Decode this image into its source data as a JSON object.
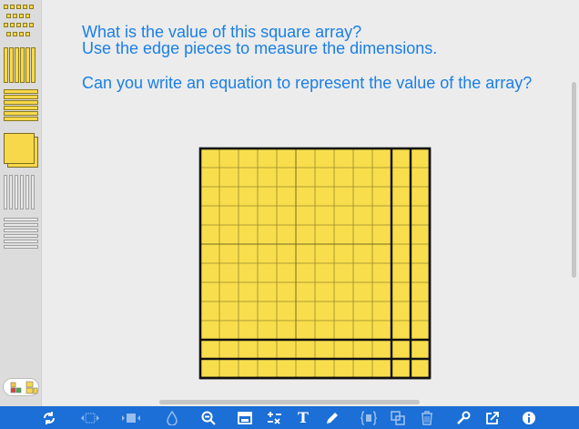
{
  "prompt": {
    "line1": "What is the value of this square array?",
    "line2": "Use the edge pieces to measure the dimensions.",
    "line3": "Can you write an equation to represent the value of the array?"
  },
  "array": {
    "fill_color": "#f8de4d",
    "grid_color": "#9a8a2a",
    "border_color": "#111111",
    "hundreds_grid": {
      "rows": 10,
      "cols": 10
    },
    "ten_rods_right": 2,
    "ten_rods_bottom": 2,
    "unit_squares": 4
  },
  "palette": {
    "items": [
      "ones-pieces",
      "ten-rods-vertical",
      "ten-rods-horizontal",
      "hundred-flat",
      "blank-ten-rods-vertical",
      "blank-ten-rods-horizontal"
    ],
    "accent": "#f7d84a"
  },
  "toolbar": {
    "bg_color": "#1b6fd6",
    "buttons": [
      "rotate-icon",
      "group-tiles-icon",
      "ungroup-tiles-icon",
      "drop-icon",
      "zoom-out-icon",
      "window-icon",
      "add-subtract-icon",
      "text-tool-icon",
      "pen-icon",
      "group-bracket-icon",
      "duplicate-icon",
      "trash-icon",
      "wrench-icon",
      "share-icon",
      "info-icon"
    ],
    "text_tool_label": "T"
  }
}
